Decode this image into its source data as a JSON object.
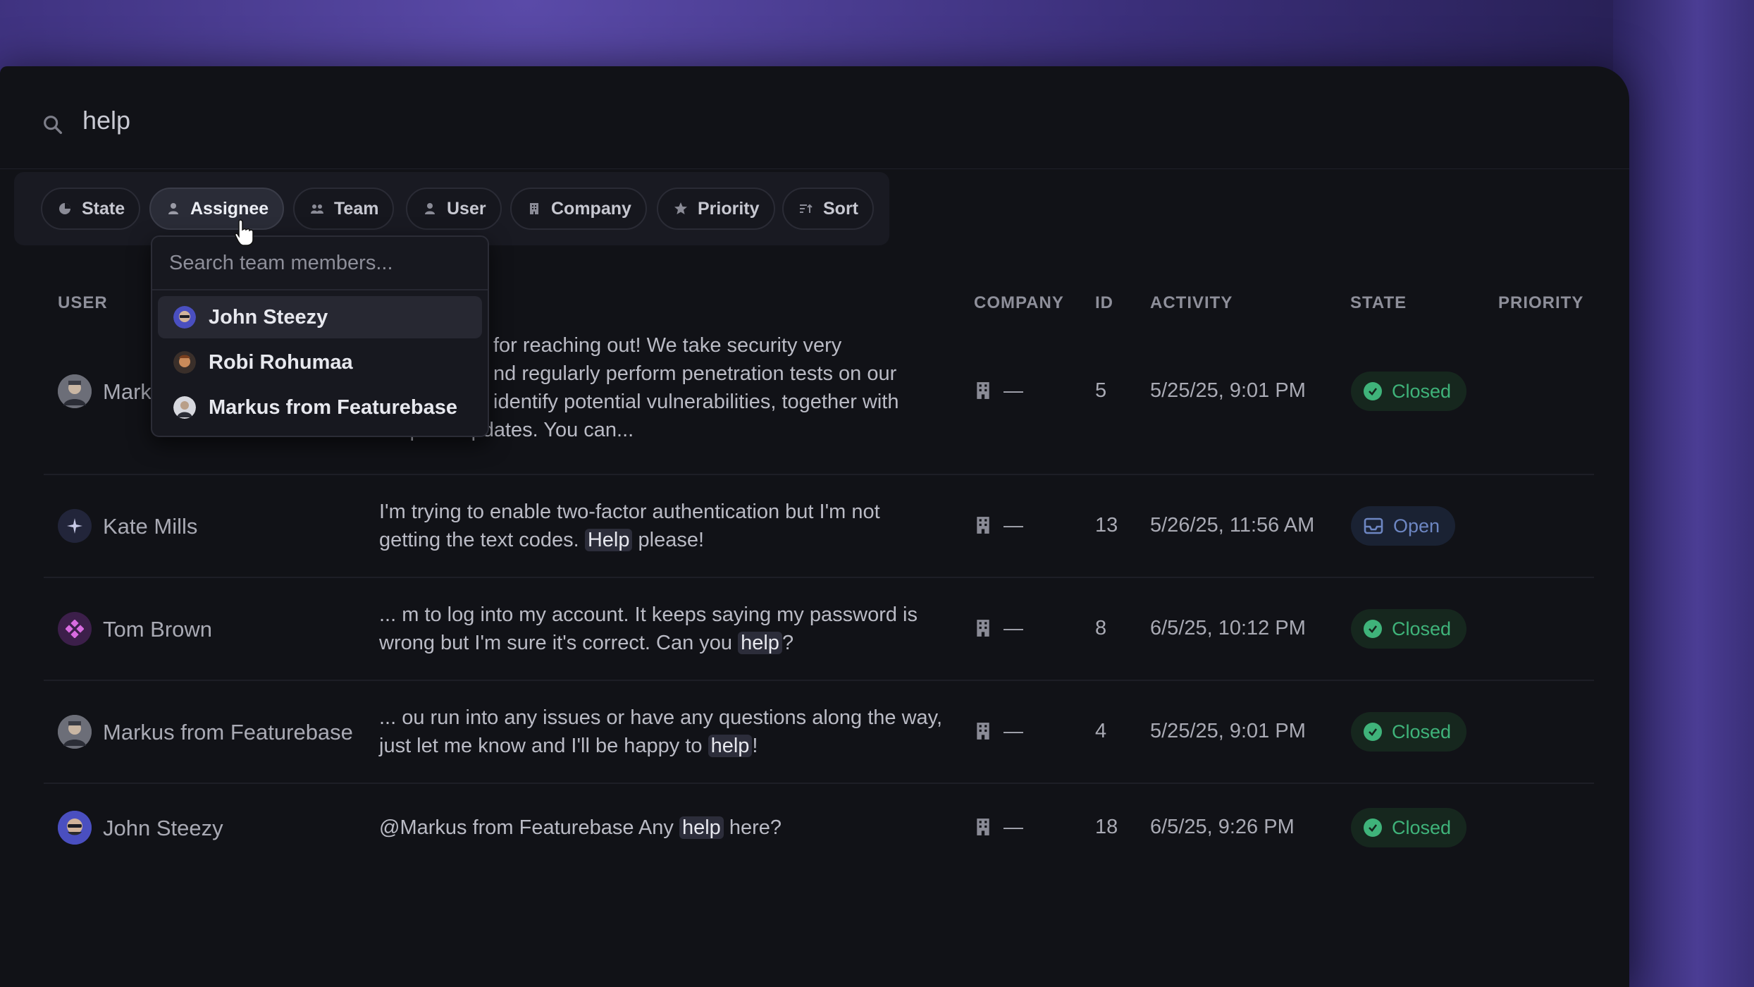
{
  "search": {
    "query": "help"
  },
  "filters": [
    {
      "label": "State",
      "icon": "state-icon"
    },
    {
      "label": "Assignee",
      "icon": "person-icon"
    },
    {
      "label": "Team",
      "icon": "team-icon"
    },
    {
      "label": "User",
      "icon": "person-icon"
    },
    {
      "label": "Company",
      "icon": "building-icon"
    },
    {
      "label": "Priority",
      "icon": "star-icon"
    },
    {
      "label": "Sort",
      "icon": "sort-icon"
    }
  ],
  "assignee_dropdown": {
    "placeholder": "Search team members...",
    "members": [
      "John Steezy",
      "Robi Rohumaa",
      "Markus from Featurebase"
    ]
  },
  "table": {
    "headers": {
      "user": "USER",
      "company": "COMPANY",
      "id": "ID",
      "activity": "ACTIVITY",
      "state": "STATE",
      "priority": "PRIORITY"
    },
    "rows": [
      {
        "user": "Markus from Featurebase",
        "user_visible": "Mark",
        "message_lines": [
          "for reaching out!  We take security very",
          "nd regularly perform penetration tests on our",
          "identify potential vulnerabilities, together with",
          "frequent updates. You can..."
        ],
        "company": "—",
        "id": "5",
        "activity": "5/25/25, 9:01 PM",
        "state": "Closed"
      },
      {
        "user": "Kate Mills",
        "message_pre": "I'm trying to enable two-factor authentication but I'm not getting the text codes. ",
        "message_hl": "Help",
        "message_post": " please!",
        "company": "—",
        "id": "13",
        "activity": "5/26/25, 11:56 AM",
        "state": "Open"
      },
      {
        "user": "Tom Brown",
        "message_pre": "... m to log into my account. It keeps saying my password is wrong but I'm sure it's correct. Can you ",
        "message_hl": "help",
        "message_post": "?",
        "company": "—",
        "id": "8",
        "activity": "6/5/25, 10:12 PM",
        "state": "Closed"
      },
      {
        "user": "Markus from Featurebase",
        "message_pre": "... ou run into any issues or have any questions along the way, just let me know and I'll be happy to ",
        "message_hl": "help",
        "message_post": "!",
        "company": "—",
        "id": "4",
        "activity": "5/25/25, 9:01 PM",
        "state": "Closed"
      },
      {
        "user": "John Steezy",
        "message_pre": "@Markus from Featurebase Any ",
        "message_hl": "help",
        "message_post": " here?",
        "company": "—",
        "id": "18",
        "activity": "6/5/25, 9:26 PM",
        "state": "Closed"
      }
    ]
  },
  "colors": {
    "closed": "#3fb37a",
    "open": "#6d86c2",
    "panel": "#111217",
    "accent": "#4b3d94"
  }
}
